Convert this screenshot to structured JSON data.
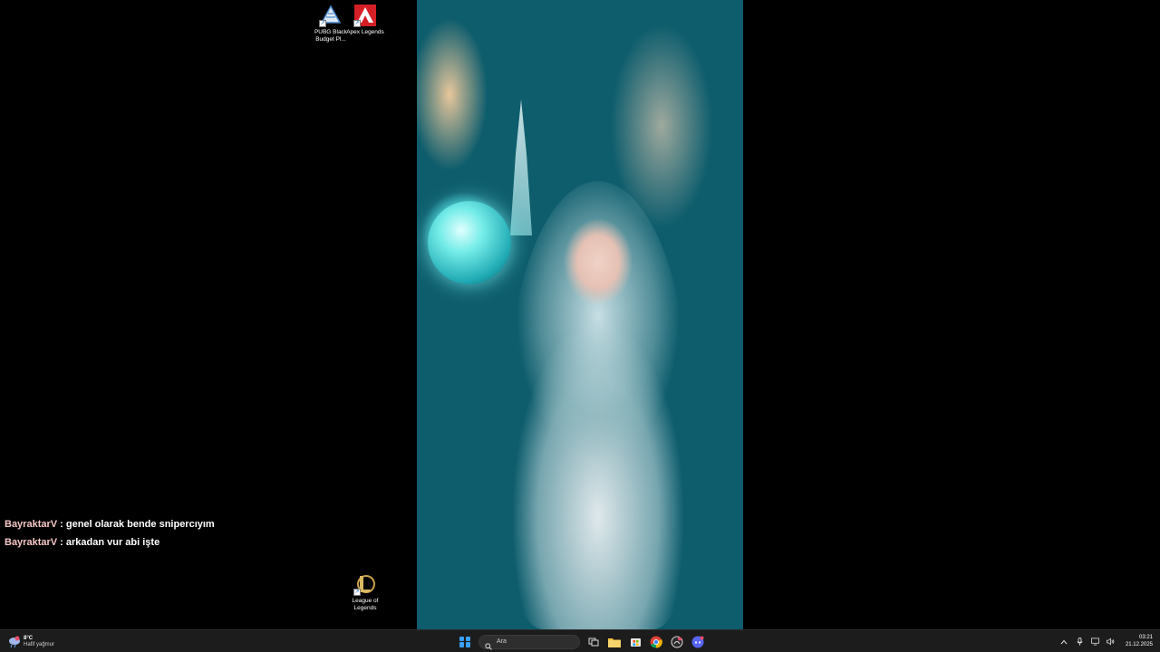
{
  "desktop": {
    "icons": [
      {
        "label": "PUBG Black Budget Pl...",
        "icon": "pubg-icon"
      },
      {
        "label": "Apex Legends",
        "icon": "apex-icon"
      },
      {
        "label": "League of Legends",
        "icon": "league-icon"
      }
    ]
  },
  "chat": {
    "messages": [
      {
        "user": "BayraktarV",
        "separator": " : ",
        "text": "genel olarak bende snipercıyım"
      },
      {
        "user": "BayraktarV",
        "separator": " : ",
        "text": "arkadan vur abi işte"
      }
    ],
    "user_color": "#f6c6c6"
  },
  "taskbar": {
    "weather": {
      "temp": "8°C",
      "desc": "Hafif yağmur",
      "icon": "rain-cloud-icon"
    },
    "search_placeholder": "Ara",
    "apps": [
      "task-view-icon",
      "file-explorer-icon",
      "microsoft-store-icon",
      "chrome-icon",
      "github-desktop-icon",
      "discord-icon"
    ],
    "tray": [
      "chevron-up-icon",
      "microphone-icon",
      "display-icon",
      "speaker-icon"
    ],
    "clock": {
      "time": "03:21",
      "date": "21.12.2025"
    },
    "accent": "#3aa0ff"
  }
}
